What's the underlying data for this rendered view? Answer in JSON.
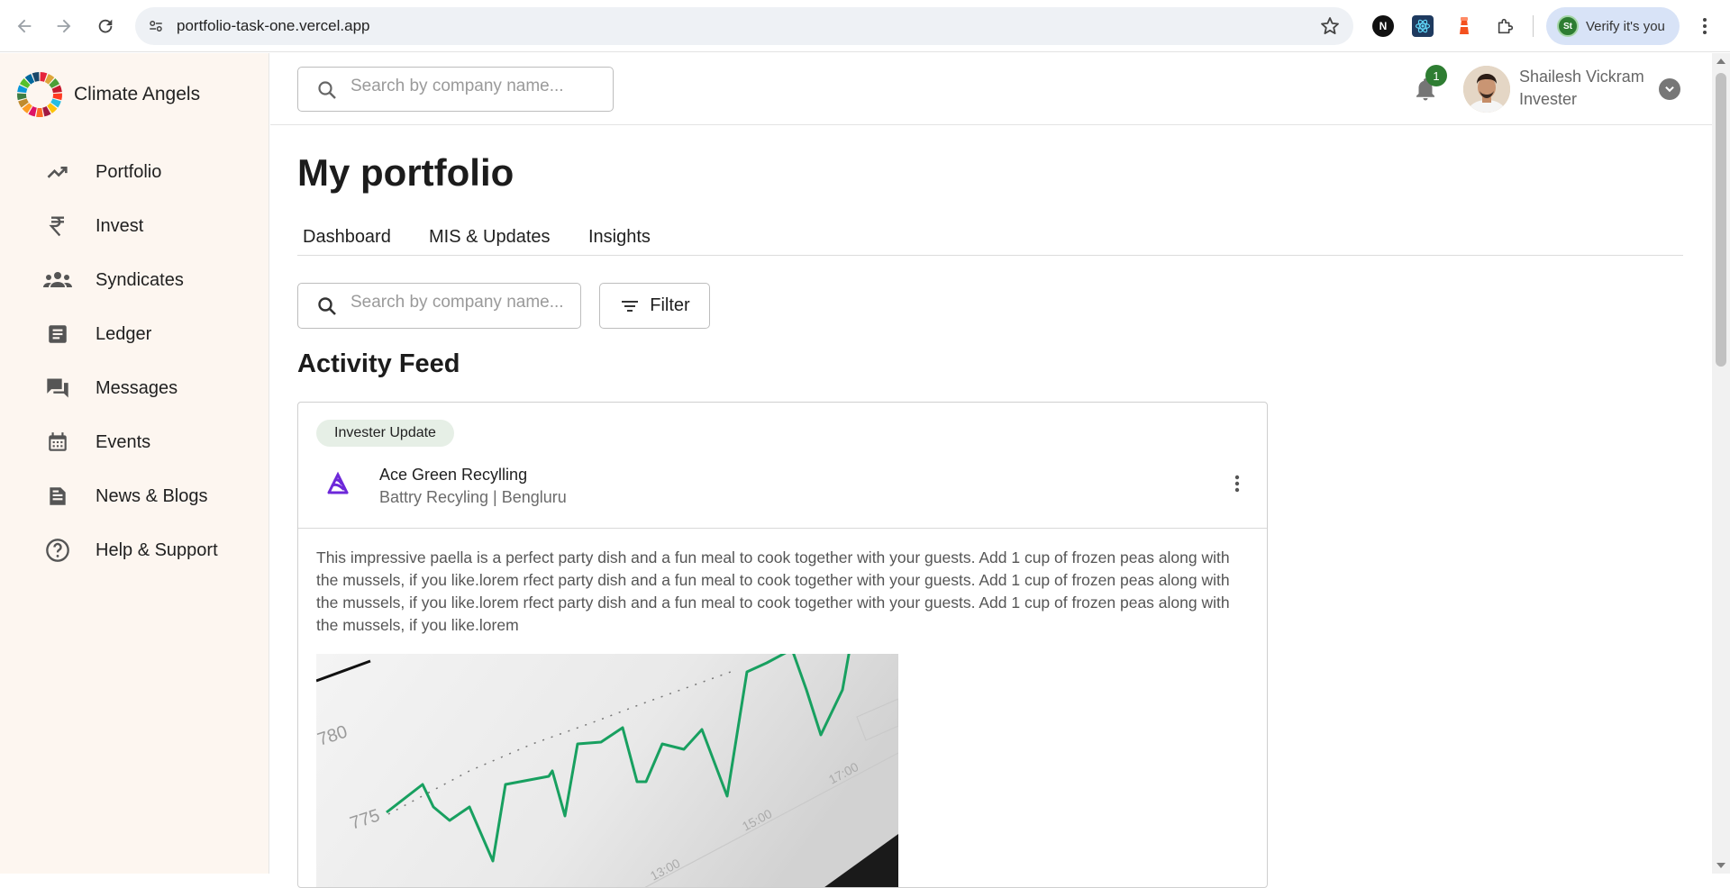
{
  "browser": {
    "url": "portfolio-task-one.vercel.app",
    "verify_label": "Verify it's you",
    "extensions": [
      "notion-icon",
      "react-icon",
      "lighthouse-icon",
      "puzzle-icon"
    ]
  },
  "sidebar": {
    "brand": "Climate Angels",
    "items": [
      {
        "label": "Portfolio",
        "icon": "trending-up-icon"
      },
      {
        "label": "Invest",
        "icon": "rupee-icon"
      },
      {
        "label": "Syndicates",
        "icon": "groups-icon"
      },
      {
        "label": "Ledger",
        "icon": "ledger-icon"
      },
      {
        "label": "Messages",
        "icon": "messages-icon"
      },
      {
        "label": "Events",
        "icon": "calendar-icon"
      },
      {
        "label": "News & Blogs",
        "icon": "article-icon"
      },
      {
        "label": "Help & Support",
        "icon": "help-icon"
      }
    ]
  },
  "topbar": {
    "search_placeholder": "Search by company name...",
    "notification_count": "1",
    "user_name": "Shailesh Vickram",
    "user_role": "Invester"
  },
  "main": {
    "title": "My portfolio",
    "tabs": [
      "Dashboard",
      "MIS & Updates",
      "Insights"
    ],
    "search_placeholder": "Search by company name...",
    "filter_label": "Filter",
    "feed_title": "Activity Feed"
  },
  "card": {
    "chip": "Invester Update",
    "company_name": "Ace Green Recylling",
    "company_meta": "Battry Recyling | Bengluru",
    "body": "This impressive paella is a perfect party dish and a fun meal to cook together with your guests. Add 1 cup of frozen peas along with the mussels, if you like.lorem rfect party dish and a fun meal to cook together with your guests. Add 1 cup of frozen peas along with the mussels, if you like.lorem rfect party dish and a fun meal to cook together with your guests. Add 1 cup of frozen peas along with the mussels, if you like.lorem",
    "image": {
      "tick_labels": [
        "780",
        "775",
        "13:00",
        "15:00",
        "17:00"
      ]
    }
  },
  "colors": {
    "sidebar_bg": "#fdf6f0",
    "accent_green": "#2e7d32",
    "chip_bg": "#e6efe6",
    "logo_purple": "#6d28d9"
  }
}
